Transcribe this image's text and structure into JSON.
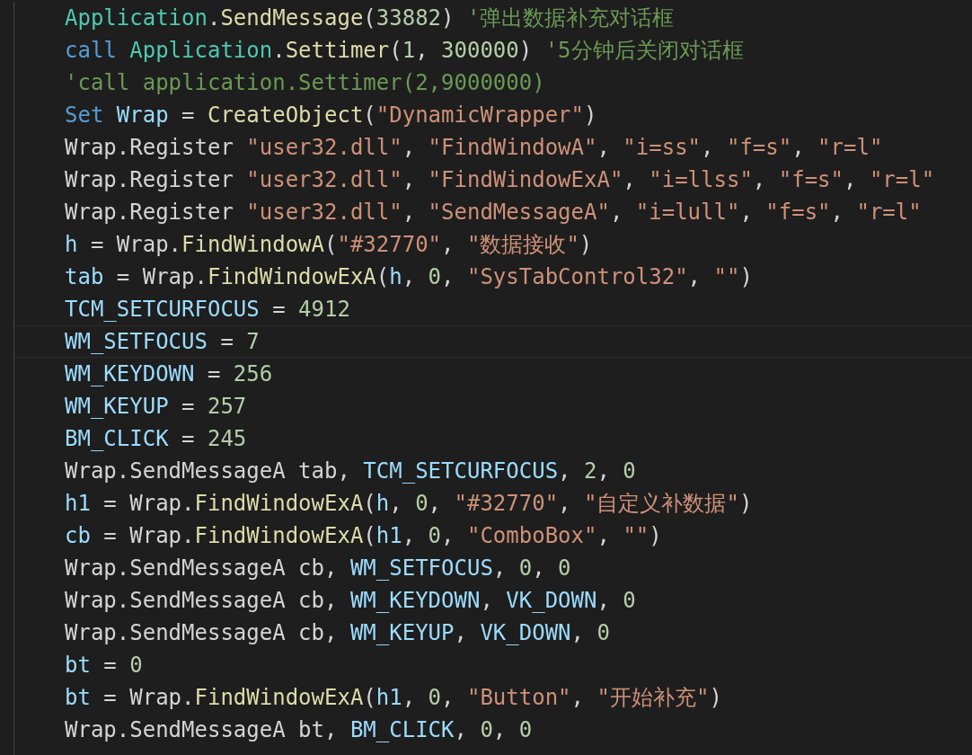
{
  "editor": {
    "lines": [
      {
        "current": false,
        "tokens": [
          {
            "kind": "class",
            "text": "Application"
          },
          {
            "kind": "plain",
            "text": "."
          },
          {
            "kind": "function",
            "text": "SendMessage"
          },
          {
            "kind": "plain",
            "text": "("
          },
          {
            "kind": "number",
            "text": "33882"
          },
          {
            "kind": "plain",
            "text": ") "
          },
          {
            "kind": "comment",
            "text": "'弹出数据补充对话框"
          }
        ]
      },
      {
        "current": false,
        "tokens": [
          {
            "kind": "keyword",
            "text": "call "
          },
          {
            "kind": "class",
            "text": "Application"
          },
          {
            "kind": "plain",
            "text": "."
          },
          {
            "kind": "function",
            "text": "Settimer"
          },
          {
            "kind": "plain",
            "text": "("
          },
          {
            "kind": "number",
            "text": "1"
          },
          {
            "kind": "plain",
            "text": ", "
          },
          {
            "kind": "number",
            "text": "300000"
          },
          {
            "kind": "plain",
            "text": ") "
          },
          {
            "kind": "comment",
            "text": "'5分钟后关闭对话框"
          }
        ]
      },
      {
        "current": false,
        "tokens": [
          {
            "kind": "comment",
            "text": "'call application.Settimer(2,9000000)"
          }
        ]
      },
      {
        "current": false,
        "tokens": [
          {
            "kind": "keyword",
            "text": "Set "
          },
          {
            "kind": "variable",
            "text": "Wrap"
          },
          {
            "kind": "plain",
            "text": " = "
          },
          {
            "kind": "function",
            "text": "CreateObject"
          },
          {
            "kind": "plain",
            "text": "("
          },
          {
            "kind": "string",
            "text": "\"DynamicWrapper\""
          },
          {
            "kind": "plain",
            "text": ")"
          }
        ]
      },
      {
        "current": false,
        "tokens": [
          {
            "kind": "plain",
            "text": "Wrap.Register "
          },
          {
            "kind": "string",
            "text": "\"user32.dll\""
          },
          {
            "kind": "plain",
            "text": ", "
          },
          {
            "kind": "string",
            "text": "\"FindWindowA\""
          },
          {
            "kind": "plain",
            "text": ", "
          },
          {
            "kind": "string",
            "text": "\"i=ss\""
          },
          {
            "kind": "plain",
            "text": ", "
          },
          {
            "kind": "string",
            "text": "\"f=s\""
          },
          {
            "kind": "plain",
            "text": ", "
          },
          {
            "kind": "string",
            "text": "\"r=l\""
          }
        ]
      },
      {
        "current": false,
        "tokens": [
          {
            "kind": "plain",
            "text": "Wrap.Register "
          },
          {
            "kind": "string",
            "text": "\"user32.dll\""
          },
          {
            "kind": "plain",
            "text": ", "
          },
          {
            "kind": "string",
            "text": "\"FindWindowExA\""
          },
          {
            "kind": "plain",
            "text": ", "
          },
          {
            "kind": "string",
            "text": "\"i=llss\""
          },
          {
            "kind": "plain",
            "text": ", "
          },
          {
            "kind": "string",
            "text": "\"f=s\""
          },
          {
            "kind": "plain",
            "text": ", "
          },
          {
            "kind": "string",
            "text": "\"r=l\""
          }
        ]
      },
      {
        "current": false,
        "tokens": [
          {
            "kind": "plain",
            "text": "Wrap.Register "
          },
          {
            "kind": "string",
            "text": "\"user32.dll\""
          },
          {
            "kind": "plain",
            "text": ", "
          },
          {
            "kind": "string",
            "text": "\"SendMessageA\""
          },
          {
            "kind": "plain",
            "text": ", "
          },
          {
            "kind": "string",
            "text": "\"i=lull\""
          },
          {
            "kind": "plain",
            "text": ", "
          },
          {
            "kind": "string",
            "text": "\"f=s\""
          },
          {
            "kind": "plain",
            "text": ", "
          },
          {
            "kind": "string",
            "text": "\"r=l\""
          }
        ]
      },
      {
        "current": false,
        "tokens": [
          {
            "kind": "variable",
            "text": "h"
          },
          {
            "kind": "plain",
            "text": " = Wrap."
          },
          {
            "kind": "function",
            "text": "FindWindowA"
          },
          {
            "kind": "plain",
            "text": "("
          },
          {
            "kind": "string",
            "text": "\"#32770\""
          },
          {
            "kind": "plain",
            "text": ", "
          },
          {
            "kind": "string",
            "text": "\"数据接收\""
          },
          {
            "kind": "plain",
            "text": ")"
          }
        ]
      },
      {
        "current": false,
        "tokens": [
          {
            "kind": "variable",
            "text": "tab"
          },
          {
            "kind": "plain",
            "text": " = Wrap."
          },
          {
            "kind": "function",
            "text": "FindWindowExA"
          },
          {
            "kind": "plain",
            "text": "("
          },
          {
            "kind": "variable",
            "text": "h"
          },
          {
            "kind": "plain",
            "text": ", "
          },
          {
            "kind": "number",
            "text": "0"
          },
          {
            "kind": "plain",
            "text": ", "
          },
          {
            "kind": "string",
            "text": "\"SysTabControl32\""
          },
          {
            "kind": "plain",
            "text": ", "
          },
          {
            "kind": "string",
            "text": "\"\""
          },
          {
            "kind": "plain",
            "text": ")"
          }
        ]
      },
      {
        "current": false,
        "tokens": [
          {
            "kind": "variable",
            "text": "TCM_SETCURFOCUS"
          },
          {
            "kind": "plain",
            "text": " = "
          },
          {
            "kind": "number",
            "text": "4912"
          }
        ]
      },
      {
        "current": true,
        "tokens": [
          {
            "kind": "variable",
            "text": "WM_SETFOCUS"
          },
          {
            "kind": "plain",
            "text": " = "
          },
          {
            "kind": "number",
            "text": "7"
          }
        ]
      },
      {
        "current": false,
        "tokens": [
          {
            "kind": "variable",
            "text": "WM_KEYDOWN"
          },
          {
            "kind": "plain",
            "text": " = "
          },
          {
            "kind": "number",
            "text": "256"
          }
        ]
      },
      {
        "current": false,
        "tokens": [
          {
            "kind": "variable",
            "text": "WM_KEYUP"
          },
          {
            "kind": "plain",
            "text": " = "
          },
          {
            "kind": "number",
            "text": "257"
          }
        ]
      },
      {
        "current": false,
        "tokens": [
          {
            "kind": "variable",
            "text": "BM_CLICK"
          },
          {
            "kind": "plain",
            "text": " = "
          },
          {
            "kind": "number",
            "text": "245"
          }
        ]
      },
      {
        "current": false,
        "tokens": [
          {
            "kind": "plain",
            "text": "Wrap.SendMessageA tab, "
          },
          {
            "kind": "variable",
            "text": "TCM_SETCURFOCUS"
          },
          {
            "kind": "plain",
            "text": ", "
          },
          {
            "kind": "number",
            "text": "2"
          },
          {
            "kind": "plain",
            "text": ", "
          },
          {
            "kind": "number",
            "text": "0"
          }
        ]
      },
      {
        "current": false,
        "tokens": [
          {
            "kind": "variable",
            "text": "h1"
          },
          {
            "kind": "plain",
            "text": " = Wrap."
          },
          {
            "kind": "function",
            "text": "FindWindowExA"
          },
          {
            "kind": "plain",
            "text": "("
          },
          {
            "kind": "variable",
            "text": "h"
          },
          {
            "kind": "plain",
            "text": ", "
          },
          {
            "kind": "number",
            "text": "0"
          },
          {
            "kind": "plain",
            "text": ", "
          },
          {
            "kind": "string",
            "text": "\"#32770\""
          },
          {
            "kind": "plain",
            "text": ", "
          },
          {
            "kind": "string",
            "text": "\"自定义补数据\""
          },
          {
            "kind": "plain",
            "text": ")"
          }
        ]
      },
      {
        "current": false,
        "tokens": [
          {
            "kind": "variable",
            "text": "cb"
          },
          {
            "kind": "plain",
            "text": " = Wrap."
          },
          {
            "kind": "function",
            "text": "FindWindowExA"
          },
          {
            "kind": "plain",
            "text": "("
          },
          {
            "kind": "variable",
            "text": "h1"
          },
          {
            "kind": "plain",
            "text": ", "
          },
          {
            "kind": "number",
            "text": "0"
          },
          {
            "kind": "plain",
            "text": ", "
          },
          {
            "kind": "string",
            "text": "\"ComboBox\""
          },
          {
            "kind": "plain",
            "text": ", "
          },
          {
            "kind": "string",
            "text": "\"\""
          },
          {
            "kind": "plain",
            "text": ")"
          }
        ]
      },
      {
        "current": false,
        "tokens": [
          {
            "kind": "plain",
            "text": "Wrap.SendMessageA cb, "
          },
          {
            "kind": "variable",
            "text": "WM_SETFOCUS"
          },
          {
            "kind": "plain",
            "text": ", "
          },
          {
            "kind": "number",
            "text": "0"
          },
          {
            "kind": "plain",
            "text": ", "
          },
          {
            "kind": "number",
            "text": "0"
          }
        ]
      },
      {
        "current": false,
        "tokens": [
          {
            "kind": "plain",
            "text": "Wrap.SendMessageA cb, "
          },
          {
            "kind": "variable",
            "text": "WM_KEYDOWN"
          },
          {
            "kind": "plain",
            "text": ", "
          },
          {
            "kind": "variable",
            "text": "VK_DOWN"
          },
          {
            "kind": "plain",
            "text": ", "
          },
          {
            "kind": "number",
            "text": "0"
          }
        ]
      },
      {
        "current": false,
        "tokens": [
          {
            "kind": "plain",
            "text": "Wrap.SendMessageA cb, "
          },
          {
            "kind": "variable",
            "text": "WM_KEYUP"
          },
          {
            "kind": "plain",
            "text": ", "
          },
          {
            "kind": "variable",
            "text": "VK_DOWN"
          },
          {
            "kind": "plain",
            "text": ", "
          },
          {
            "kind": "number",
            "text": "0"
          }
        ]
      },
      {
        "current": false,
        "tokens": [
          {
            "kind": "variable",
            "text": "bt"
          },
          {
            "kind": "plain",
            "text": " = "
          },
          {
            "kind": "number",
            "text": "0"
          }
        ]
      },
      {
        "current": false,
        "tokens": [
          {
            "kind": "variable",
            "text": "bt"
          },
          {
            "kind": "plain",
            "text": " = Wrap."
          },
          {
            "kind": "function",
            "text": "FindWindowExA"
          },
          {
            "kind": "plain",
            "text": "("
          },
          {
            "kind": "variable",
            "text": "h1"
          },
          {
            "kind": "plain",
            "text": ", "
          },
          {
            "kind": "number",
            "text": "0"
          },
          {
            "kind": "plain",
            "text": ", "
          },
          {
            "kind": "string",
            "text": "\"Button\""
          },
          {
            "kind": "plain",
            "text": ", "
          },
          {
            "kind": "string",
            "text": "\"开始补充\""
          },
          {
            "kind": "plain",
            "text": ")"
          }
        ]
      },
      {
        "current": false,
        "tokens": [
          {
            "kind": "plain",
            "text": "Wrap.SendMessageA bt, "
          },
          {
            "kind": "variable",
            "text": "BM_CLICK"
          },
          {
            "kind": "plain",
            "text": ", "
          },
          {
            "kind": "number",
            "text": "0"
          },
          {
            "kind": "plain",
            "text": ", "
          },
          {
            "kind": "number",
            "text": "0"
          }
        ]
      }
    ]
  }
}
